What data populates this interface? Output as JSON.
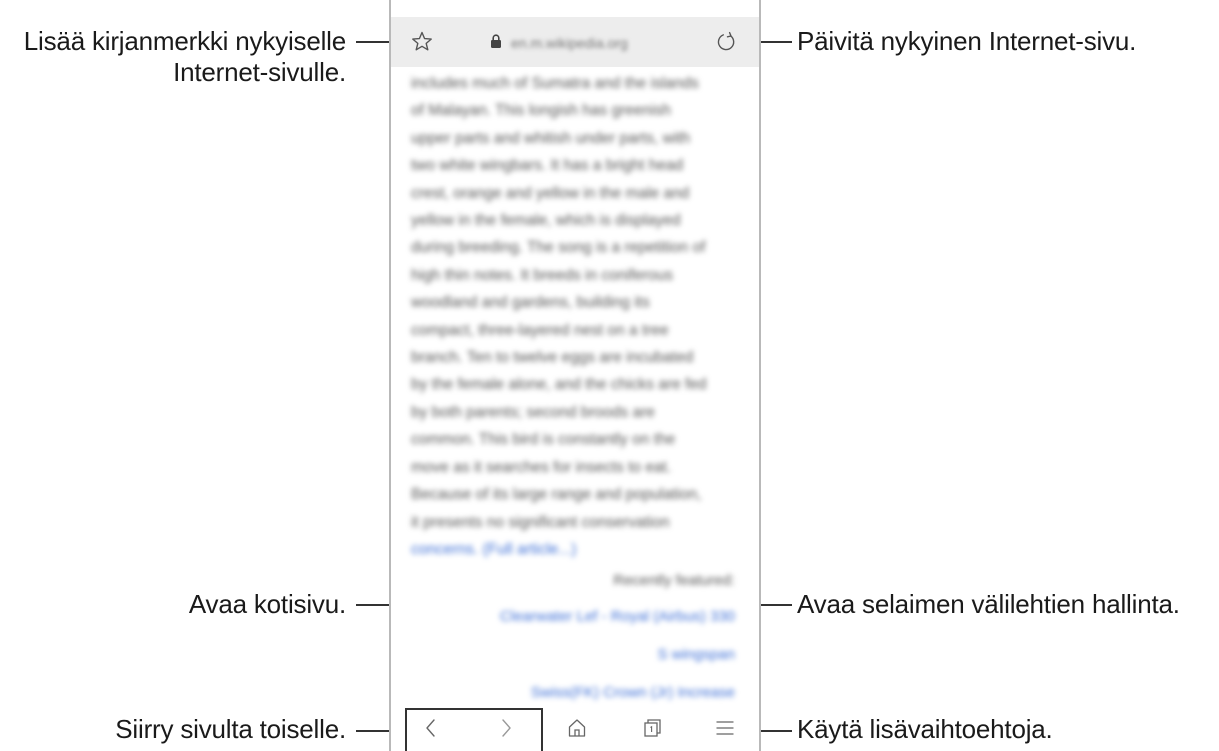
{
  "callouts": {
    "bookmark_line1": "Lisää kirjanmerkki nykyiselle",
    "bookmark_line2": "Internet-sivulle.",
    "refresh": "Päivitä nykyinen Internet-sivu.",
    "home": "Avaa kotisivu.",
    "tabs": "Avaa selaimen välilehtien hallinta.",
    "nav": "Siirry sivulta toiselle.",
    "more": "Käytä lisävaihtoehtoja."
  },
  "browser": {
    "url": "en.m.wikipedia.org",
    "icons": {
      "bookmark": "star-icon",
      "lock": "lock-icon",
      "refresh": "refresh-icon",
      "back": "chevron-left-icon",
      "forward": "chevron-right-icon",
      "home": "home-icon",
      "tabs": "tabs-icon",
      "menu": "menu-icon"
    }
  },
  "article": {
    "lines": [
      "includes much of Sumatra and the islands",
      "of Malayan. This longish has greenish",
      "upper parts and whitish under parts, with",
      "two white wingbars. It has a bright head",
      "crest, orange and yellow in the male and",
      "yellow in the female, which is displayed",
      "during breeding. The song is a repetition of",
      "high thin notes. It breeds in coniferous",
      "woodland and gardens, building its",
      "compact, three-layered nest on a tree",
      "branch. Ten to twelve eggs are incubated",
      "by the female alone, and the chicks are fed",
      "by both parents; second broods are",
      "common. This bird is constantly on the",
      "move as it searches for insects to eat.",
      "Because of its large range and population,",
      "it presents no significant conservation",
      "concerns. (Full article...)"
    ],
    "recent_heading": "Recently featured:",
    "recent_links": [
      "Clearwater Lef - Royal (Airbus) 330",
      "S wingspan",
      "Swiss(FK) Crown (Jr) Increase"
    ]
  }
}
